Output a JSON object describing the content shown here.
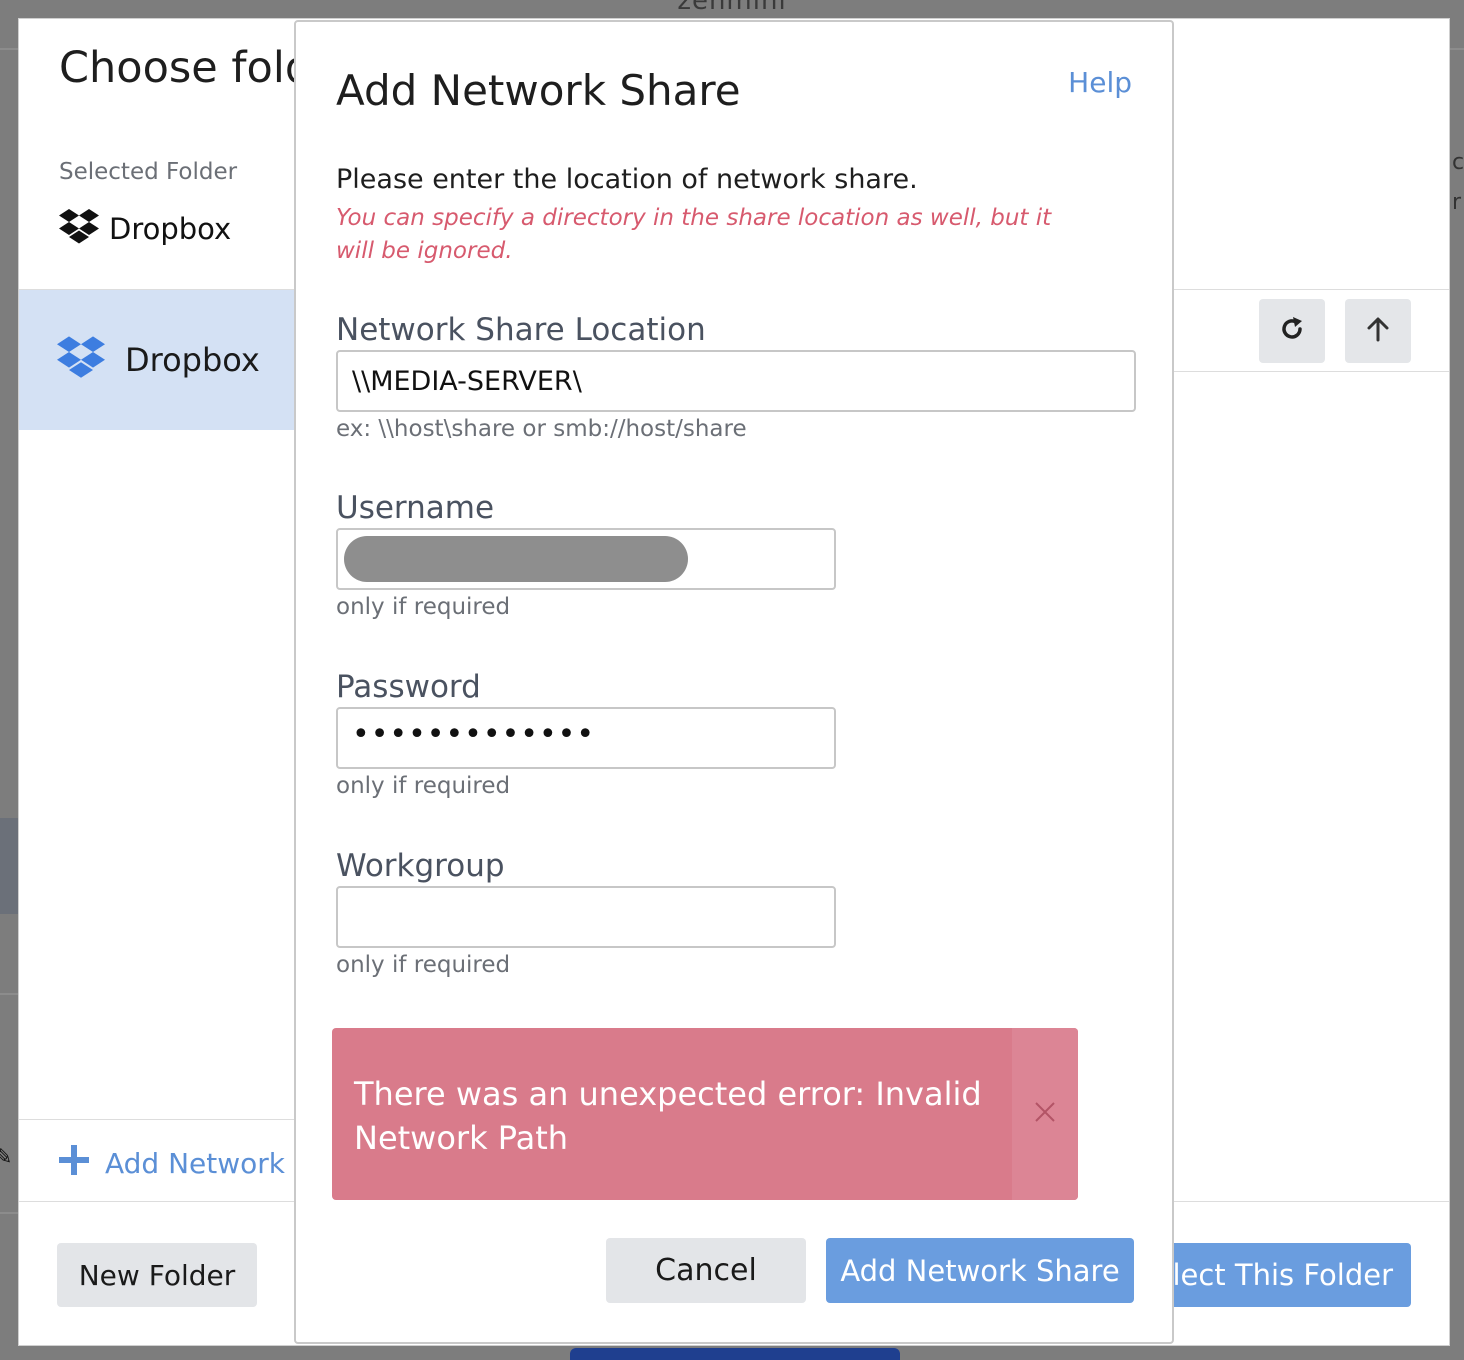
{
  "app": {
    "title": "zenmini"
  },
  "chooser": {
    "title": "Choose fold",
    "selected_label": "Selected Folder",
    "selected_value": "Dropbox",
    "sidebar_items": [
      {
        "label": "Dropbox",
        "icon": "dropbox-icon"
      }
    ],
    "add_network_link": "Add Network S",
    "new_folder_label": "New Folder",
    "select_folder_label": "elect This Folder",
    "toolbar": {
      "refresh_icon": "refresh-icon",
      "up_icon": "arrow-up-icon"
    }
  },
  "modal": {
    "title": "Add Network Share",
    "help": "Help",
    "intro": "Please enter the location of network share.",
    "hint": "You can specify a directory in the share location as well, but it will be ignored.",
    "location": {
      "label": "Network Share Location",
      "value": "\\\\MEDIA-SERVER\\",
      "help": "ex: \\\\host\\share or smb://host/share"
    },
    "username": {
      "label": "Username",
      "value": "",
      "help": "only if required"
    },
    "password": {
      "label": "Password",
      "masked": "•••••••••••••",
      "help": "only if required"
    },
    "workgroup": {
      "label": "Workgroup",
      "value": "",
      "help": "only if required"
    },
    "error": {
      "message": "There was an unexpected error: Invalid Network Path",
      "color": "#d97b8b"
    },
    "cancel_label": "Cancel",
    "submit_label": "Add Network Share"
  },
  "colors": {
    "accent": "#6a9ddf",
    "link": "#5b8fd6",
    "hint": "#d75a6e",
    "selected_row": "#d4e1f4"
  }
}
